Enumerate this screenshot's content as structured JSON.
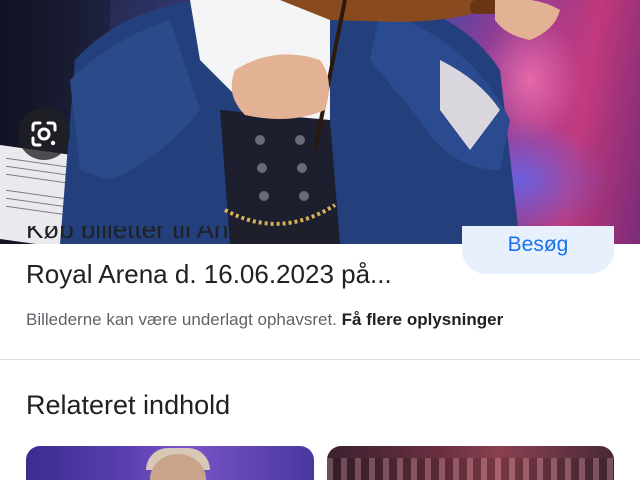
{
  "image_result": {
    "partial_title_top": "Køb billetter til André Rieu i",
    "title_line": "Royal Arena d. 16.06.2023 på...",
    "visit_button": "Besøg",
    "copyright_text": "Billederne kan være underlagt ophavsret.",
    "learn_more_link": "Få flere oplysninger",
    "lens_icon": "google-lens-icon"
  },
  "related": {
    "heading": "Relateret indhold"
  },
  "colors": {
    "accent": "#1a73e8",
    "visit_button_bg": "#e8f0fe",
    "text_primary": "#202124",
    "text_secondary": "#5f6368"
  }
}
